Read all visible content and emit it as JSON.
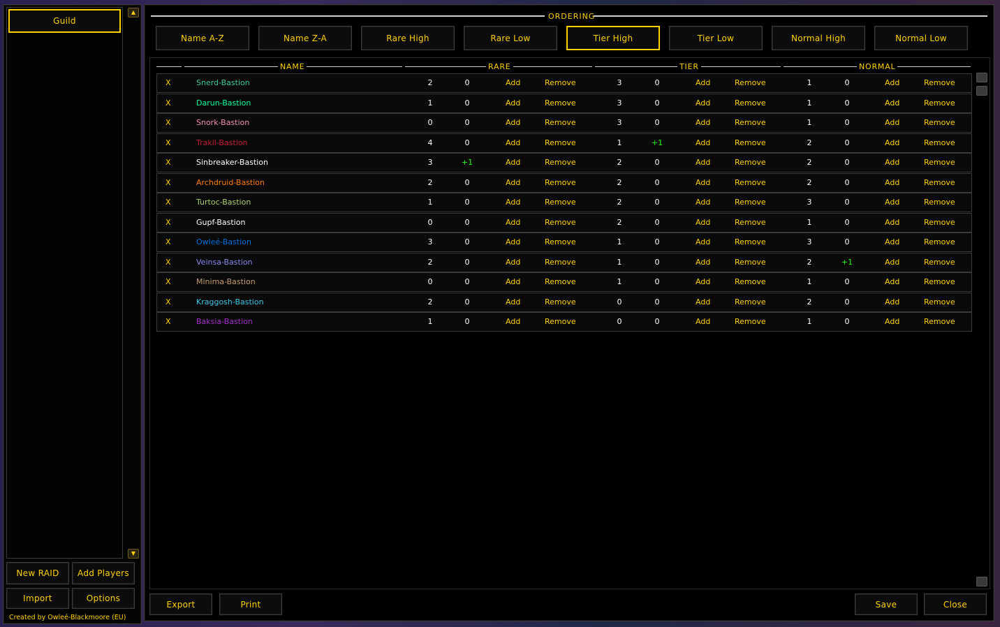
{
  "left_panel": {
    "guild_button": "Guild",
    "new_raid": "New RAID",
    "add_players": "Add Players",
    "import": "Import",
    "options": "Options",
    "credit": "Created by Owleé-Blackmoore (EU)"
  },
  "ordering": {
    "title": "ORDERING",
    "buttons": [
      "Name A-Z",
      "Name Z-A",
      "Rare High",
      "Rare Low",
      "Tier High",
      "Tier Low",
      "Normal High",
      "Normal Low"
    ],
    "active": "Tier High"
  },
  "columns": {
    "name": "NAME",
    "rare": "RARE",
    "tier": "TIER",
    "normal": "NORMAL"
  },
  "row_labels": {
    "delete": "X",
    "add": "Add",
    "remove": "Remove"
  },
  "players": [
    {
      "name": "Snerd-Bastion",
      "color": "#3fc7a0",
      "rare": "2",
      "rare_mod": "0",
      "tier": "3",
      "tier_mod": "0",
      "normal": "1",
      "normal_mod": "0"
    },
    {
      "name": "Darun-Bastion",
      "color": "#00ff98",
      "rare": "1",
      "rare_mod": "0",
      "tier": "3",
      "tier_mod": "0",
      "normal": "1",
      "normal_mod": "0"
    },
    {
      "name": "Snork-Bastion",
      "color": "#f48cba",
      "rare": "0",
      "rare_mod": "0",
      "tier": "3",
      "tier_mod": "0",
      "normal": "1",
      "normal_mod": "0"
    },
    {
      "name": "Trakil-Bastion",
      "color": "#c41e3a",
      "rare": "4",
      "rare_mod": "0",
      "tier": "1",
      "tier_mod": "+1",
      "normal": "2",
      "normal_mod": "0"
    },
    {
      "name": "Sinbreaker-Bastion",
      "color": "#ffffff",
      "rare": "3",
      "rare_mod": "+1",
      "tier": "2",
      "tier_mod": "0",
      "normal": "2",
      "normal_mod": "0"
    },
    {
      "name": "Archdruid-Bastion",
      "color": "#ff7c0a",
      "rare": "2",
      "rare_mod": "0",
      "tier": "2",
      "tier_mod": "0",
      "normal": "2",
      "normal_mod": "0"
    },
    {
      "name": "Turtoc-Bastion",
      "color": "#aad372",
      "rare": "1",
      "rare_mod": "0",
      "tier": "2",
      "tier_mod": "0",
      "normal": "3",
      "normal_mod": "0"
    },
    {
      "name": "Gupf-Bastion",
      "color": "#ffffff",
      "rare": "0",
      "rare_mod": "0",
      "tier": "2",
      "tier_mod": "0",
      "normal": "1",
      "normal_mod": "0"
    },
    {
      "name": "Owleé-Bastion",
      "color": "#0070dd",
      "rare": "3",
      "rare_mod": "0",
      "tier": "1",
      "tier_mod": "0",
      "normal": "3",
      "normal_mod": "0"
    },
    {
      "name": "Veinsa-Bastion",
      "color": "#8788ee",
      "rare": "2",
      "rare_mod": "0",
      "tier": "1",
      "tier_mod": "0",
      "normal": "2",
      "normal_mod": "+1"
    },
    {
      "name": "Minima-Bastion",
      "color": "#c69b6d",
      "rare": "0",
      "rare_mod": "0",
      "tier": "1",
      "tier_mod": "0",
      "normal": "1",
      "normal_mod": "0"
    },
    {
      "name": "Kraggosh-Bastion",
      "color": "#3fc7eb",
      "rare": "2",
      "rare_mod": "0",
      "tier": "0",
      "tier_mod": "0",
      "normal": "2",
      "normal_mod": "0"
    },
    {
      "name": "Baksia-Bastion",
      "color": "#a330c9",
      "rare": "1",
      "rare_mod": "0",
      "tier": "0",
      "tier_mod": "0",
      "normal": "1",
      "normal_mod": "0"
    }
  ],
  "footer": {
    "export": "Export",
    "print": "Print",
    "save": "Save",
    "close": "Close"
  }
}
